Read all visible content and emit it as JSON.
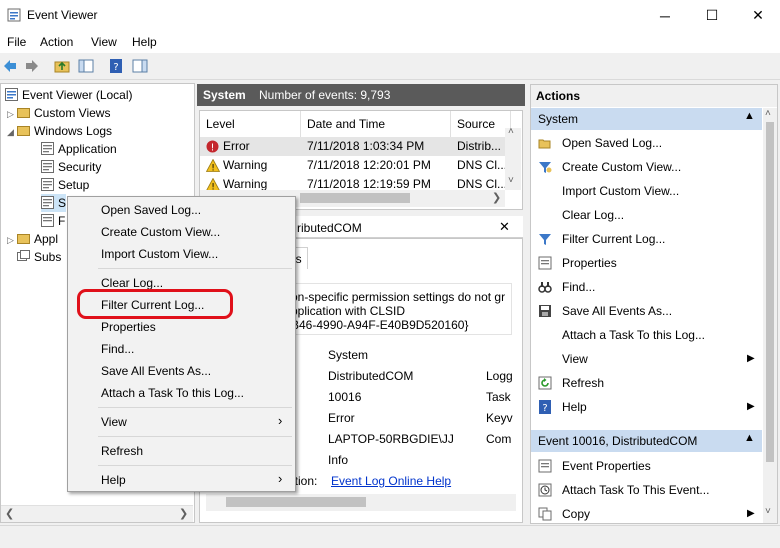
{
  "window": {
    "title": "Event Viewer",
    "minimize": "─",
    "maximize": "☐",
    "close": "✕"
  },
  "menu": {
    "file": "File",
    "action": "Action",
    "view": "View",
    "help": "Help"
  },
  "tree": {
    "root": "Event Viewer (Local)",
    "custom_views": "Custom Views",
    "windows_logs": "Windows Logs",
    "application": "Application",
    "security": "Security",
    "setup": "Setup",
    "system_partial": "S",
    "forwarded_partial": "F",
    "applications_partial": "Appl",
    "subscriptions_partial": "Subs"
  },
  "center": {
    "log_name": "System",
    "event_count": "Number of events: 9,793",
    "columns": {
      "level": "Level",
      "datetime": "Date and Time",
      "source": "Source"
    },
    "rows": [
      {
        "level": "Error",
        "datetime": "7/11/2018 1:03:34 PM",
        "source": "Distrib..."
      },
      {
        "level": "Warning",
        "datetime": "7/11/2018 12:20:01 PM",
        "source": "DNS Cl..."
      },
      {
        "level": "Warning",
        "datetime": "7/11/2018 12:19:59 PM",
        "source": "DNS Cl..."
      }
    ],
    "detail": {
      "title_partial": "ributedCOM",
      "tab_partial": "ls",
      "message_line1": "on-specific permission settings do not gr",
      "message_line2": "pplication with CLSID",
      "message_line3": "B46-4990-A94F-E40B9D520160}",
      "log_name": "System",
      "source": "DistributedCOM",
      "event_id": "10016",
      "level": "Error",
      "computer": "LAPTOP-50RBGDIE\\JJ",
      "opcode": "Info",
      "right_col_1": "Logg",
      "right_col_2": "Task",
      "right_col_3": "Keyv",
      "right_col_4": "Com",
      "more_info_partial": "ation:",
      "more_info_link": "Event Log Online Help"
    }
  },
  "actions": {
    "title": "Actions",
    "section1": "System",
    "items1": [
      "Open Saved Log...",
      "Create Custom View...",
      "Import Custom View...",
      "Clear Log...",
      "Filter Current Log...",
      "Properties",
      "Find...",
      "Save All Events As...",
      "Attach a Task To this Log...",
      "View",
      "Refresh",
      "Help"
    ],
    "section2": "Event 10016, DistributedCOM",
    "items2": [
      "Event Properties",
      "Attach Task To This Event...",
      "Copy"
    ]
  },
  "context_menu": {
    "open_saved": "Open Saved Log...",
    "create_view": "Create Custom View...",
    "import_view": "Import Custom View...",
    "clear_log": "Clear Log...",
    "filter_log": "Filter Current Log...",
    "properties": "Properties",
    "find": "Find...",
    "save_all": "Save All Events As...",
    "attach_task": "Attach a Task To this Log...",
    "view": "View",
    "refresh": "Refresh",
    "help": "Help"
  },
  "colors": {
    "highlight_ring": "#e0101a",
    "section_header": "#c9dbf0",
    "center_header": "#5a5a5a",
    "link": "#0033cc"
  }
}
